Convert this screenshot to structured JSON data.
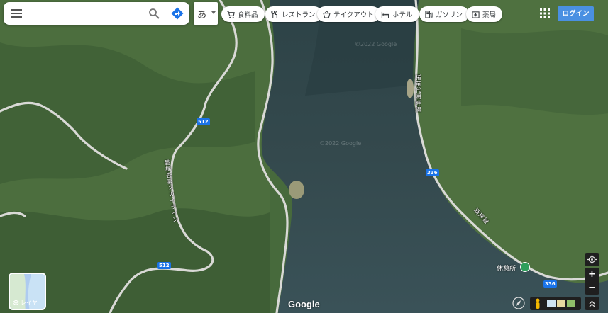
{
  "search": {
    "placeholder": "",
    "value": ""
  },
  "ime": {
    "label": "あ"
  },
  "chips": [
    {
      "label": "食料品",
      "icon": "cart-icon"
    },
    {
      "label": "レストラン",
      "icon": "restaurant-icon"
    },
    {
      "label": "テイクアウト",
      "icon": "takeout-icon"
    },
    {
      "label": "ホテル",
      "icon": "hotel-icon"
    },
    {
      "label": "ガソリン",
      "icon": "gas-station-icon"
    },
    {
      "label": "薬局",
      "icon": "pharmacy-icon"
    }
  ],
  "header": {
    "login_label": "ログイン"
  },
  "layers": {
    "label": "レイヤ"
  },
  "map": {
    "poi": "休憩所",
    "route_shields": [
      "512",
      "512",
      "336",
      "336"
    ],
    "road_labels": {
      "left": "磐梯吾妻スカイライン",
      "lake_east": "猪苗代湖畔線",
      "lake_south": "湖岸線"
    },
    "attribution": "Google",
    "watermarks": [
      "©2022 Google",
      "©2022 Google"
    ]
  },
  "colors": {
    "water": "#2f4a4e",
    "forest": "#3f5f35",
    "road": "#d8d8d8",
    "login": "#4a90e2"
  }
}
